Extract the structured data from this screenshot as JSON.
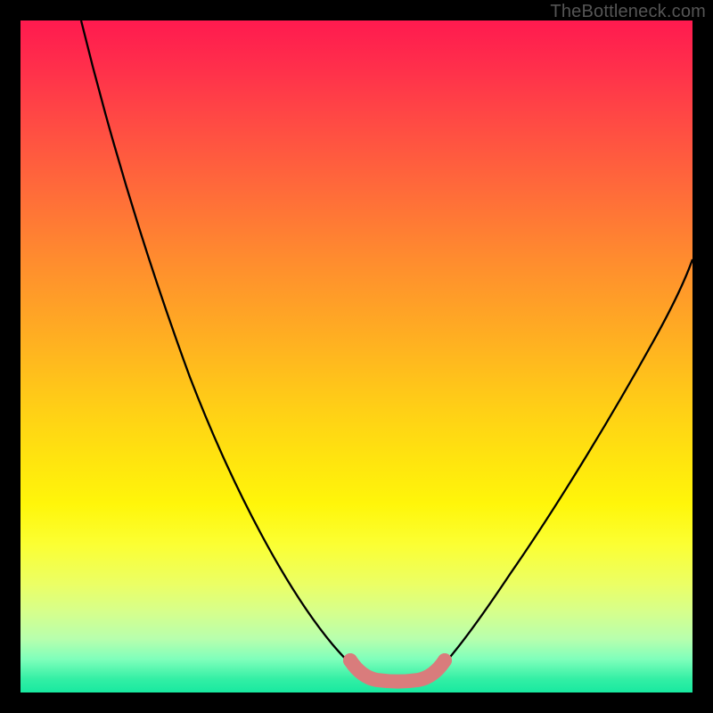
{
  "watermark": "TheBottleneck.com",
  "chart_data": {
    "type": "line",
    "title": "",
    "xlabel": "",
    "ylabel": "",
    "xlim": [
      0,
      100
    ],
    "ylim": [
      0,
      100
    ],
    "series": [
      {
        "name": "bottleneck-curve-left",
        "x": [
          10,
          15,
          20,
          25,
          30,
          35,
          40,
          45,
          48,
          50
        ],
        "y": [
          100,
          90,
          78,
          64,
          50,
          36,
          22,
          10,
          5,
          3
        ]
      },
      {
        "name": "bottleneck-curve-right",
        "x": [
          60,
          63,
          67,
          72,
          78,
          85,
          92,
          100
        ],
        "y": [
          3,
          6,
          12,
          20,
          30,
          42,
          54,
          66
        ]
      },
      {
        "name": "flat-bottom-marker",
        "x": [
          48,
          50,
          53,
          57,
          60,
          62
        ],
        "y": [
          4,
          2.5,
          2,
          2,
          2.5,
          4
        ]
      }
    ],
    "colors": {
      "curve": "#000000",
      "marker": "#d97c7c",
      "gradient_top": "#ff1a4f",
      "gradient_bottom": "#18e9a0"
    }
  }
}
